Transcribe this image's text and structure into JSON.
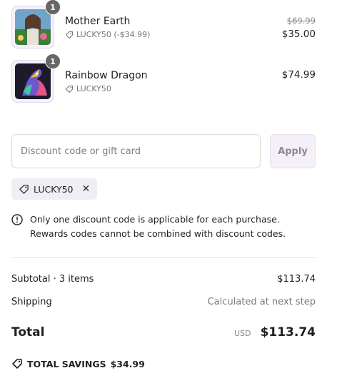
{
  "items": [
    {
      "name": "Mother Earth",
      "quantity": "1",
      "discount_code": "LUCKY50 (-$34.99)",
      "original_price": "$69.99",
      "price": "$35.00"
    },
    {
      "name": "Rainbow Dragon",
      "quantity": "1",
      "discount_code": "LUCKY50",
      "price": "$74.99"
    }
  ],
  "discount": {
    "placeholder": "Discount code or gift card",
    "apply_label": "Apply",
    "applied_code": "LUCKY50",
    "notice_line1": "Only one discount code is applicable for each purchase.",
    "notice_line2": "Rewards codes cannot be combined with discount codes."
  },
  "summary": {
    "subtotal_label": "Subtotal · 3 items",
    "subtotal_value": "$113.74",
    "shipping_label": "Shipping",
    "shipping_value": "Calculated at next step",
    "total_label": "Total",
    "currency": "USD",
    "total_value": "$113.74",
    "savings_label": "TOTAL SAVINGS",
    "savings_value": "$34.99"
  },
  "colors": {
    "accent_bg": "#f4eff8",
    "qty_badge": "#666666"
  }
}
